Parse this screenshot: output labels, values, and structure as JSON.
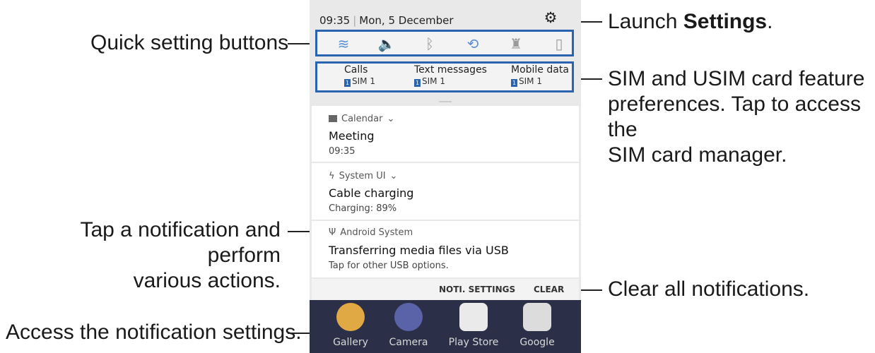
{
  "status": {
    "time": "09:35",
    "date": "Mon, 5 December"
  },
  "quick_settings": [
    {
      "name": "wifi-icon",
      "glyph": "≋"
    },
    {
      "name": "sound-icon",
      "glyph": "🔈"
    },
    {
      "name": "bluetooth-icon",
      "glyph": "ᛒ"
    },
    {
      "name": "auto-rotate-icon",
      "glyph": "⟲"
    },
    {
      "name": "flashlight-icon",
      "glyph": "♜"
    },
    {
      "name": "power-saving-icon",
      "glyph": "▯"
    }
  ],
  "sim_prefs": [
    {
      "label": "Calls",
      "sim": "SIM 1"
    },
    {
      "label": "Text messages",
      "sim": "SIM 1"
    },
    {
      "label": "Mobile data",
      "sim": "SIM 1"
    }
  ],
  "notifications": [
    {
      "app": "Calendar",
      "title": "Meeting",
      "sub": "09:35"
    },
    {
      "app": "System UI",
      "title": "Cable charging",
      "sub": "Charging: 89%"
    },
    {
      "app": "Android System",
      "title": "Transferring media files via USB",
      "sub": "Tap for other USB options."
    }
  ],
  "actions": {
    "noti_settings": "NOTI. SETTINGS",
    "clear": "CLEAR"
  },
  "home_apps": [
    "Gallery",
    "Camera",
    "Play Store",
    "Google"
  ],
  "callouts": {
    "quick_setting": "Quick setting buttons",
    "settings_pre": "Launch ",
    "settings_bold": "Settings",
    "settings_post": ".",
    "sim_line1": "SIM and USIM card feature",
    "sim_line2": "preferences. Tap to access the",
    "sim_line3": "SIM card manager.",
    "tap_line1": "Tap a notification and perform",
    "tap_line2": "various actions.",
    "clear": "Clear all notifications.",
    "noti": "Access the notification settings."
  },
  "colors": {
    "accent": "#2a64b0",
    "qs_icon": "#5b8fd6"
  }
}
